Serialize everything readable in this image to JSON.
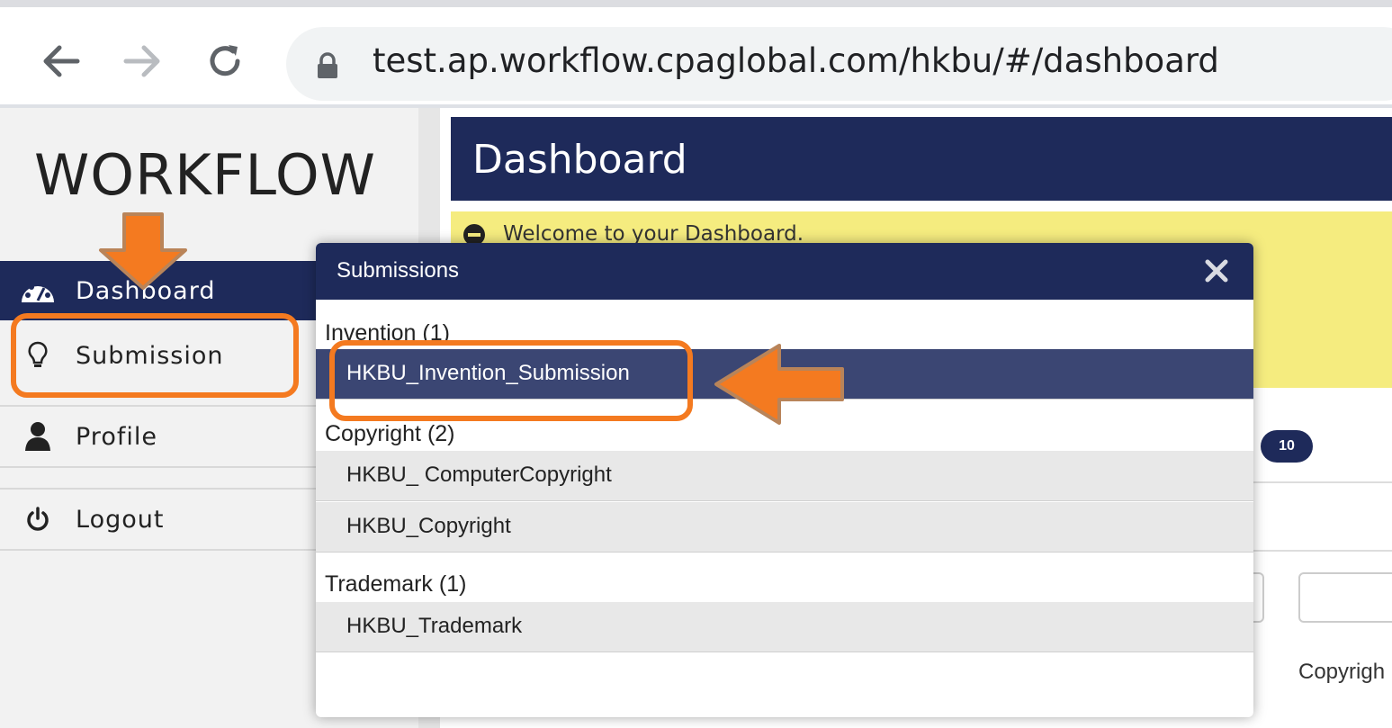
{
  "browser": {
    "url": "test.ap.workflow.cpaglobal.com/hkbu/#/dashboard"
  },
  "sidebar": {
    "logo": "WORKFLOW",
    "items": [
      {
        "label": "Dashboard",
        "icon": "dashboard-gauge-icon",
        "active": true
      },
      {
        "label": "Submission",
        "icon": "lightbulb-icon"
      },
      {
        "label": "Profile",
        "icon": "user-icon"
      },
      {
        "label": "Logout",
        "icon": "power-icon"
      }
    ]
  },
  "main": {
    "title": "Dashboard",
    "welcome": "Welcome to your Dashboard.",
    "badge_count": "10",
    "row_text": "Copyrigh"
  },
  "modal": {
    "title": "Submissions",
    "groups": [
      {
        "heading": "Invention (1)",
        "items": [
          "HKBU_Invention_Submission"
        ]
      },
      {
        "heading": "Copyright (2)",
        "items": [
          "HKBU_ ComputerCopyright",
          "HKBU_Copyright"
        ]
      },
      {
        "heading": "Trademark (1)",
        "items": [
          "HKBU_Trademark"
        ]
      }
    ],
    "selected": "HKBU_Invention_Submission"
  },
  "colors": {
    "navy": "#1e2a5a",
    "selected_row": "#3b4673",
    "welcome_bg": "#f5ec7f",
    "annotation": "#f47a20"
  }
}
